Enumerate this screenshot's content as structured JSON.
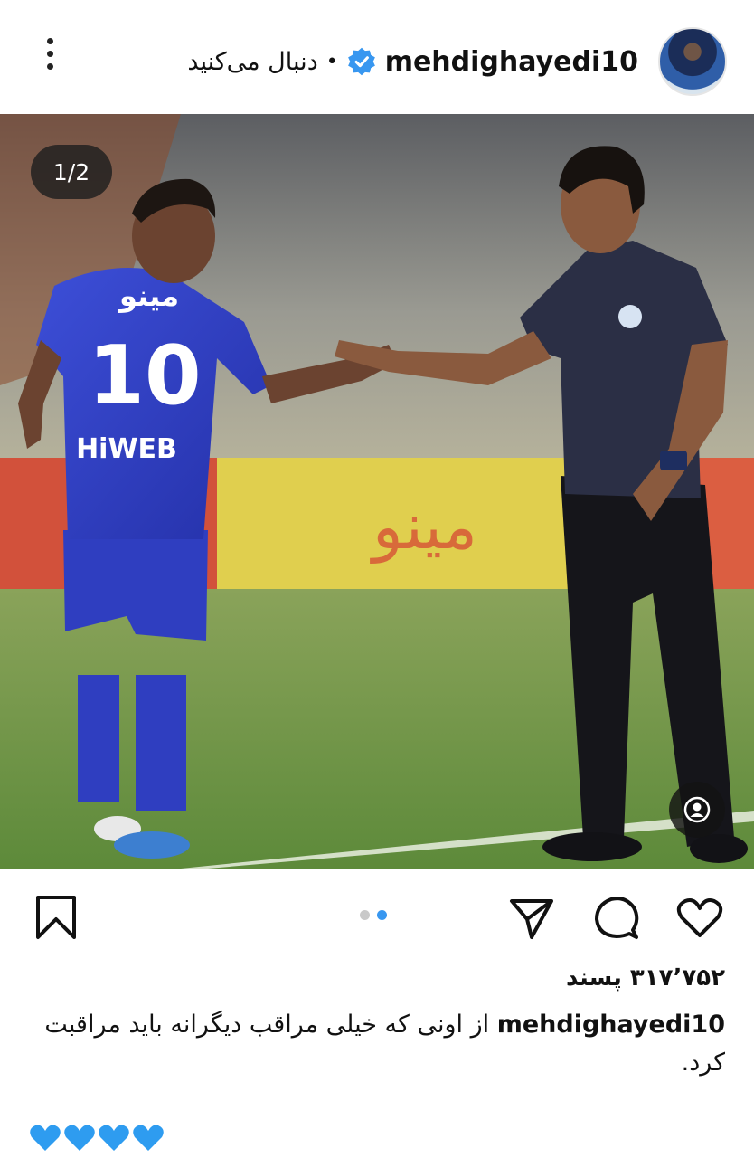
{
  "header": {
    "username": "mehdighayedi10",
    "separator": "•",
    "follow_label": "دنبال می‌کنید"
  },
  "photo": {
    "counter": "1/2",
    "player_number": "10",
    "shirt_sponsor_top": "مینو",
    "shirt_sponsor_bottom": "HiWEB",
    "billboard_text": "مینو"
  },
  "carousel": {
    "total": 2,
    "active": 2
  },
  "likes": "۳۱۷٬۷۵۲ پسند",
  "caption": {
    "username": "mehdighayedi10",
    "text": "از اونی که خیلی مراقب دیگرانه باید مراقبت کرد."
  },
  "comment_preview": {
    "hearts": "💙💙💙💙"
  },
  "colors": {
    "accent": "#3897f0",
    "heart_blue": "#2e9cf0",
    "kit_blue": "#2f3ec0"
  }
}
